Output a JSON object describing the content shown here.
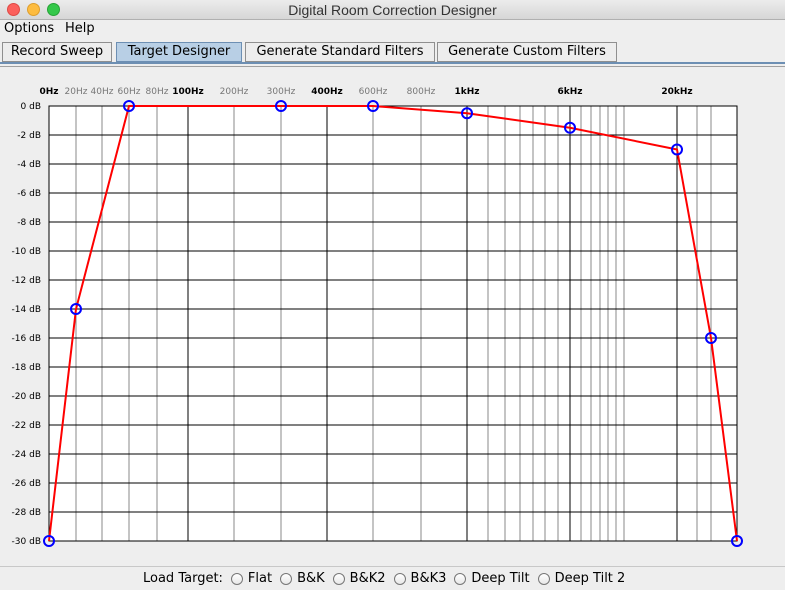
{
  "window": {
    "title": "Digital Room Correction Designer"
  },
  "menu": {
    "items": [
      "Options",
      "Help"
    ]
  },
  "tabs": [
    {
      "label": "Record Sweep",
      "active": false
    },
    {
      "label": "Target Designer",
      "active": true
    },
    {
      "label": "Generate Standard Filters",
      "active": false
    },
    {
      "label": "Generate Custom Filters",
      "active": false
    }
  ],
  "bottom": {
    "label": "Load Target:",
    "options": [
      "Flat",
      "B&K",
      "B&K2",
      "B&K3",
      "Deep Tilt",
      "Deep Tilt 2"
    ]
  },
  "colors": {
    "curve": "#ff0000",
    "points": "#0000ff",
    "accent": "#b8cfe5"
  },
  "chart_data": {
    "type": "line",
    "x_tick_labels": [
      {
        "label": "0Hz",
        "bold": true
      },
      {
        "label": "20Hz",
        "bold": false
      },
      {
        "label": "40Hz",
        "bold": false
      },
      {
        "label": "60Hz",
        "bold": false
      },
      {
        "label": "80Hz",
        "bold": false
      },
      {
        "label": "100Hz",
        "bold": true
      },
      {
        "label": "200Hz",
        "bold": false
      },
      {
        "label": "300Hz",
        "bold": false
      },
      {
        "label": "400Hz",
        "bold": true
      },
      {
        "label": "600Hz",
        "bold": false
      },
      {
        "label": "800Hz",
        "bold": false
      },
      {
        "label": "1kHz",
        "bold": true
      },
      {
        "label": "6kHz",
        "bold": true
      },
      {
        "label": "20kHz",
        "bold": true
      }
    ],
    "y_tick_labels": [
      "0 dB",
      "-2 dB",
      "-4 dB",
      "-6 dB",
      "-8 dB",
      "-10 dB",
      "-12 dB",
      "-14 dB",
      "-16 dB",
      "-18 dB",
      "-20 dB",
      "-22 dB",
      "-24 dB",
      "-26 dB",
      "-28 dB",
      "-30 dB"
    ],
    "ylim": [
      -30,
      0
    ],
    "series": [
      {
        "points": [
          {
            "x": "0Hz",
            "y": -30
          },
          {
            "x": "20Hz",
            "y": -14
          },
          {
            "x": "60Hz",
            "y": 0
          },
          {
            "x": "300Hz",
            "y": 0
          },
          {
            "x": "600Hz",
            "y": 0
          },
          {
            "x": "1kHz",
            "y": -0.5
          },
          {
            "x": "6kHz",
            "y": -1.5
          },
          {
            "x": "20kHz",
            "y": -3
          },
          {
            "x": "",
            "y": -16
          },
          {
            "x": "",
            "y": -30
          }
        ]
      }
    ]
  }
}
